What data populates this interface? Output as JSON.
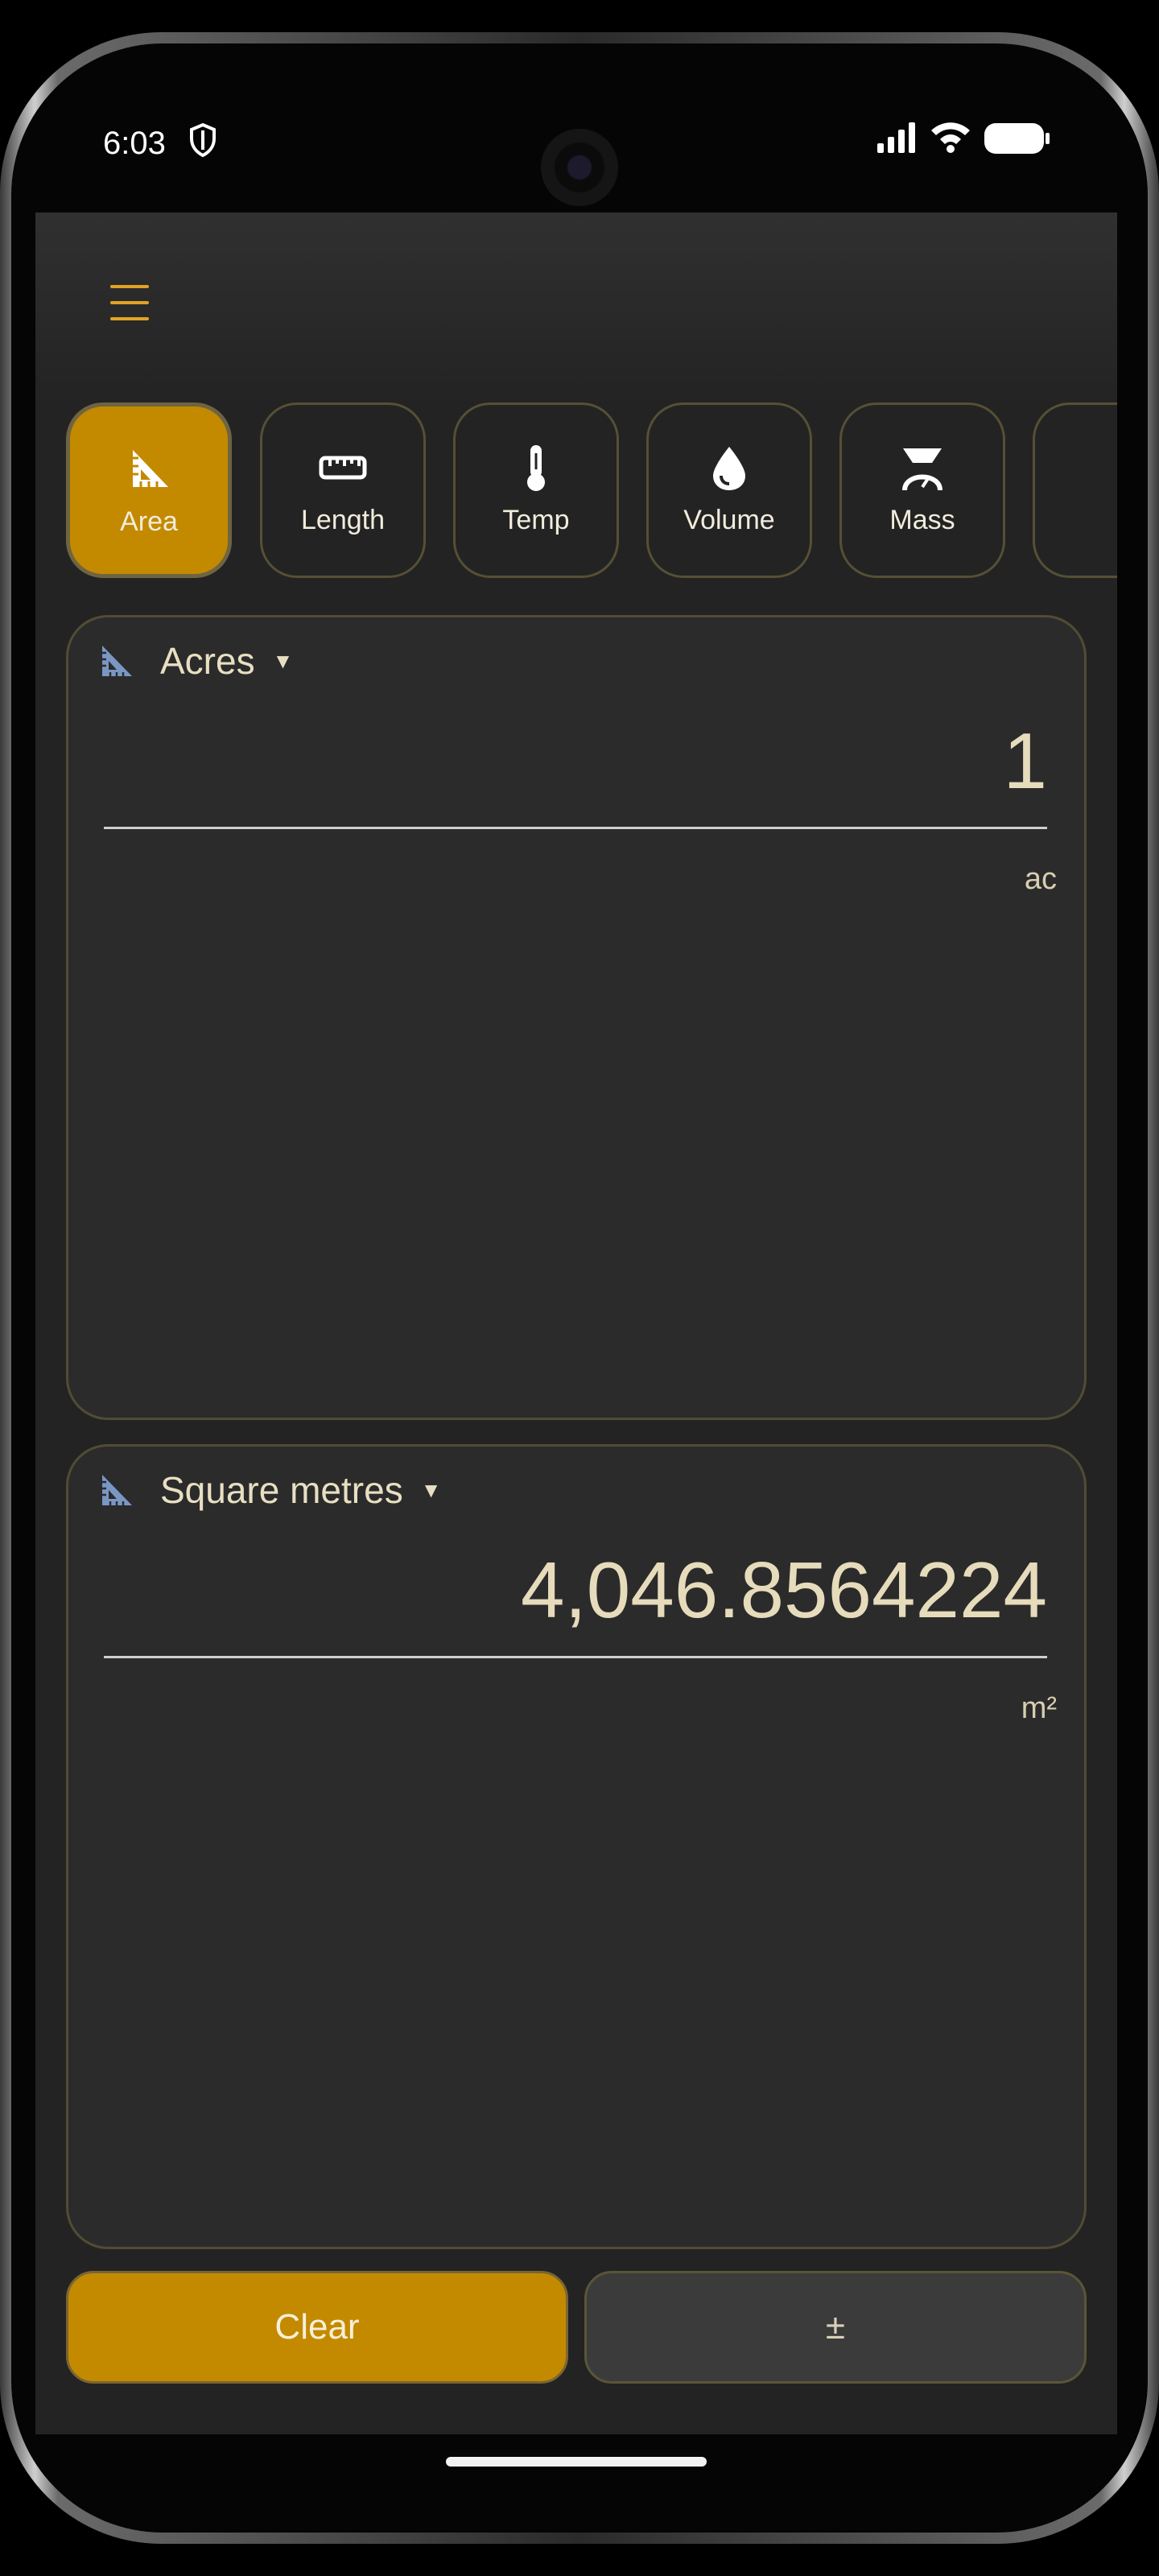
{
  "status_bar": {
    "time": "6:03",
    "icons": [
      "shield-icon",
      "signal-icon",
      "wifi-icon",
      "battery-icon"
    ]
  },
  "app": {
    "menu_icon": "hamburger-menu-icon",
    "accent_color": "#c38a00",
    "categories": [
      {
        "label": "Area",
        "icon": "set-square-icon",
        "active": true
      },
      {
        "label": "Length",
        "icon": "ruler-icon",
        "active": false
      },
      {
        "label": "Temp",
        "icon": "thermometer-icon",
        "active": false
      },
      {
        "label": "Volume",
        "icon": "droplet-icon",
        "active": false
      },
      {
        "label": "Mass",
        "icon": "scale-icon",
        "active": false
      }
    ]
  },
  "from_card": {
    "unit_name": "Acres",
    "value": "1",
    "abbreviation": "ac",
    "icon": "set-square-icon"
  },
  "to_card": {
    "unit_name": "Square metres",
    "value": "4,046.8564224",
    "abbreviation": "m²",
    "icon": "set-square-icon"
  },
  "actions": {
    "clear_label": "Clear",
    "sign_label": "±"
  }
}
